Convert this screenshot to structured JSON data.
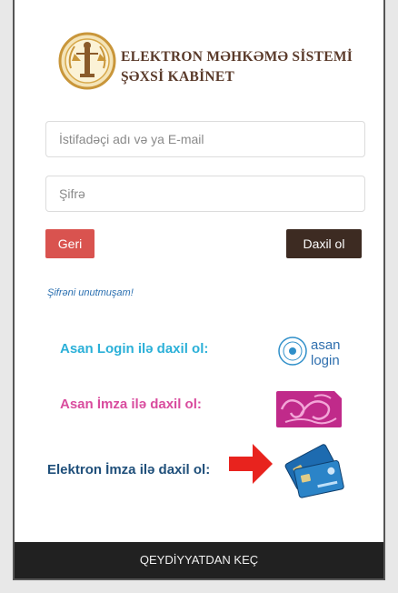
{
  "header": {
    "title_line1": "ELEKTRON MƏHKƏMƏ SİSTEMİ",
    "title_line2": "ŞƏXSİ KABİNET",
    "logo_icon": "court-emblem-icon"
  },
  "form": {
    "username_placeholder": "İstifadəçi adı və ya E-mail",
    "password_placeholder": "Şifrə",
    "back_label": "Geri",
    "login_label": "Daxil ol",
    "forgot_label": "Şifrəni unutmuşam!"
  },
  "alt_login": {
    "asan_login_label": "Asan Login ilə daxil ol:",
    "asan_login_logo_text_1": "asan",
    "asan_login_logo_text_2": "login",
    "asan_imza_label": "Asan İmza ilə daxil ol:",
    "e_imza_label": "Elektron İmza ilə daxil ol:"
  },
  "footer": {
    "register_label": "QEYDİYYATDAN KEÇ"
  },
  "colors": {
    "back_button": "#d9534f",
    "login_button": "#3d2b22",
    "asan_login": "#2bb0d8",
    "asan_imza": "#d94c9e",
    "e_imza": "#1f4f7a",
    "footer": "#212121"
  }
}
